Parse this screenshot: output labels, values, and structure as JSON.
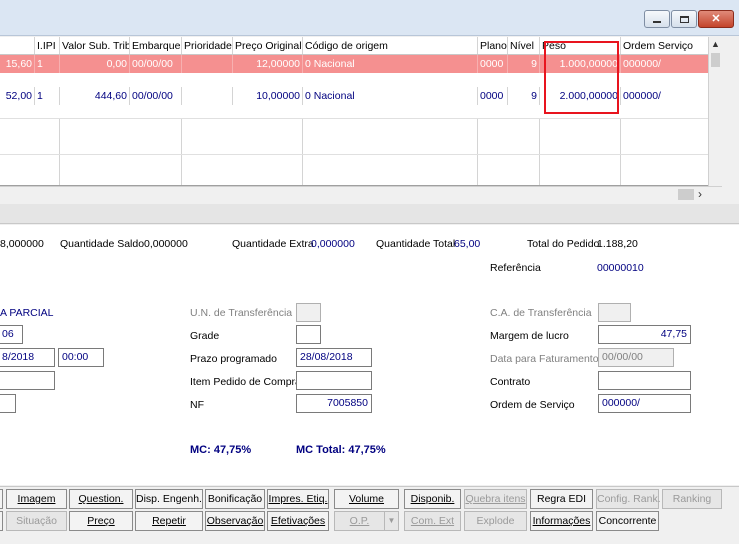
{
  "grid": {
    "headers": {
      "ipi": "I.IPI",
      "valor_sub_trib": "Valor Sub. Trib.",
      "embarque": "Embarque",
      "prioridade": "Prioridade",
      "preco_original": "Preço Original",
      "codigo_origem": "Código de origem",
      "plano": "Plano",
      "nivel": "Nível",
      "peso": "Peso",
      "ordem_servico": "Ordem Serviço"
    },
    "rows": [
      {
        "col0": "15,60",
        "ipi": "1",
        "valor_sub_trib": "0,00",
        "embarque": "00/00/00",
        "prioridade": "",
        "preco_original": "12,00000",
        "codigo_origem": "0 Nacional",
        "plano": "0000",
        "nivel": "9",
        "peso": "1.000,00000",
        "ordem_servico": "000000/"
      },
      {
        "col0": "52,00",
        "ipi": "1",
        "valor_sub_trib": "444,60",
        "embarque": "00/00/00",
        "prioridade": "",
        "preco_original": "10,00000",
        "codigo_origem": "0 Nacional",
        "plano": "0000",
        "nivel": "9",
        "peso": "2.000,00000",
        "ordem_servico": "000000/"
      }
    ]
  },
  "summary": {
    "qtd_prev": "8,000000",
    "qtd_saldo_label": "Quantidade Saldo",
    "qtd_saldo": "0,000000",
    "qtd_extra_label": "Quantidade Extra",
    "qtd_extra": "0,000000",
    "qtd_total_label": "Quantidade Total",
    "qtd_total": "65,00",
    "total_pedido_label": "Total do Pedido",
    "total_pedido": "1.188,20",
    "referencia_label": "Referência",
    "referencia": "00000010"
  },
  "form": {
    "parcial": "A PARCIAL",
    "field_06": "06",
    "date_left": "8/2018",
    "time_left": "00:00",
    "un_transferencia_label": "U.N. de Transferência",
    "grade_label": "Grade",
    "prazo_label": "Prazo programado",
    "prazo_value": "28/08/2018",
    "item_pedido_label": "Item Pedido de Compra",
    "nf_label": "NF",
    "nf_value": "7005850",
    "ca_transferencia_label": "C.A. de Transferência",
    "margem_label": "Margem de lucro",
    "margem_value": "47,75",
    "data_faturamento_label": "Data para Faturamento",
    "data_faturamento_value": "00/00/00",
    "contrato_label": "Contrato",
    "ordem_servico_label": "Ordem de Serviço",
    "ordem_servico_value": "000000/",
    "mc": "MC: 47,75%",
    "mc_total": "MC Total: 47,75%"
  },
  "buttons_row1": [
    {
      "label": "Imagem",
      "enabled": true
    },
    {
      "label": "Question.",
      "enabled": true
    },
    {
      "label": "Disp. Engenh.",
      "enabled": true
    },
    {
      "label": "Bonificação",
      "enabled": true
    },
    {
      "label": "Impres. Etiq.",
      "enabled": true
    },
    {
      "label": "Volume",
      "enabled": true
    },
    {
      "label": "Disponib.",
      "enabled": true
    },
    {
      "label": "Quebra itens",
      "enabled": false
    },
    {
      "label": "Regra EDI",
      "enabled": true
    },
    {
      "label": "Config. Rank.",
      "enabled": false
    },
    {
      "label": "Ranking",
      "enabled": false
    }
  ],
  "buttons_row2": [
    {
      "label": "Situação",
      "enabled": false
    },
    {
      "label": "Preço",
      "enabled": true
    },
    {
      "label": "Repetir",
      "enabled": true
    },
    {
      "label": "Observação",
      "enabled": true
    },
    {
      "label": "Efetivações",
      "enabled": true
    },
    {
      "label": "O.P.",
      "enabled": false
    },
    {
      "label": "Com. Ext",
      "enabled": false
    },
    {
      "label": "Explode",
      "enabled": false
    },
    {
      "label": "Informações",
      "enabled": true
    },
    {
      "label": "Concorrente",
      "enabled": true
    }
  ],
  "colors": {
    "highlight_row": "#f59090",
    "value_text": "#000080",
    "annotation_box": "#e8141e"
  },
  "icons": {
    "minimize": "minimize-icon",
    "maximize": "maximize-icon",
    "close": "close-icon"
  }
}
